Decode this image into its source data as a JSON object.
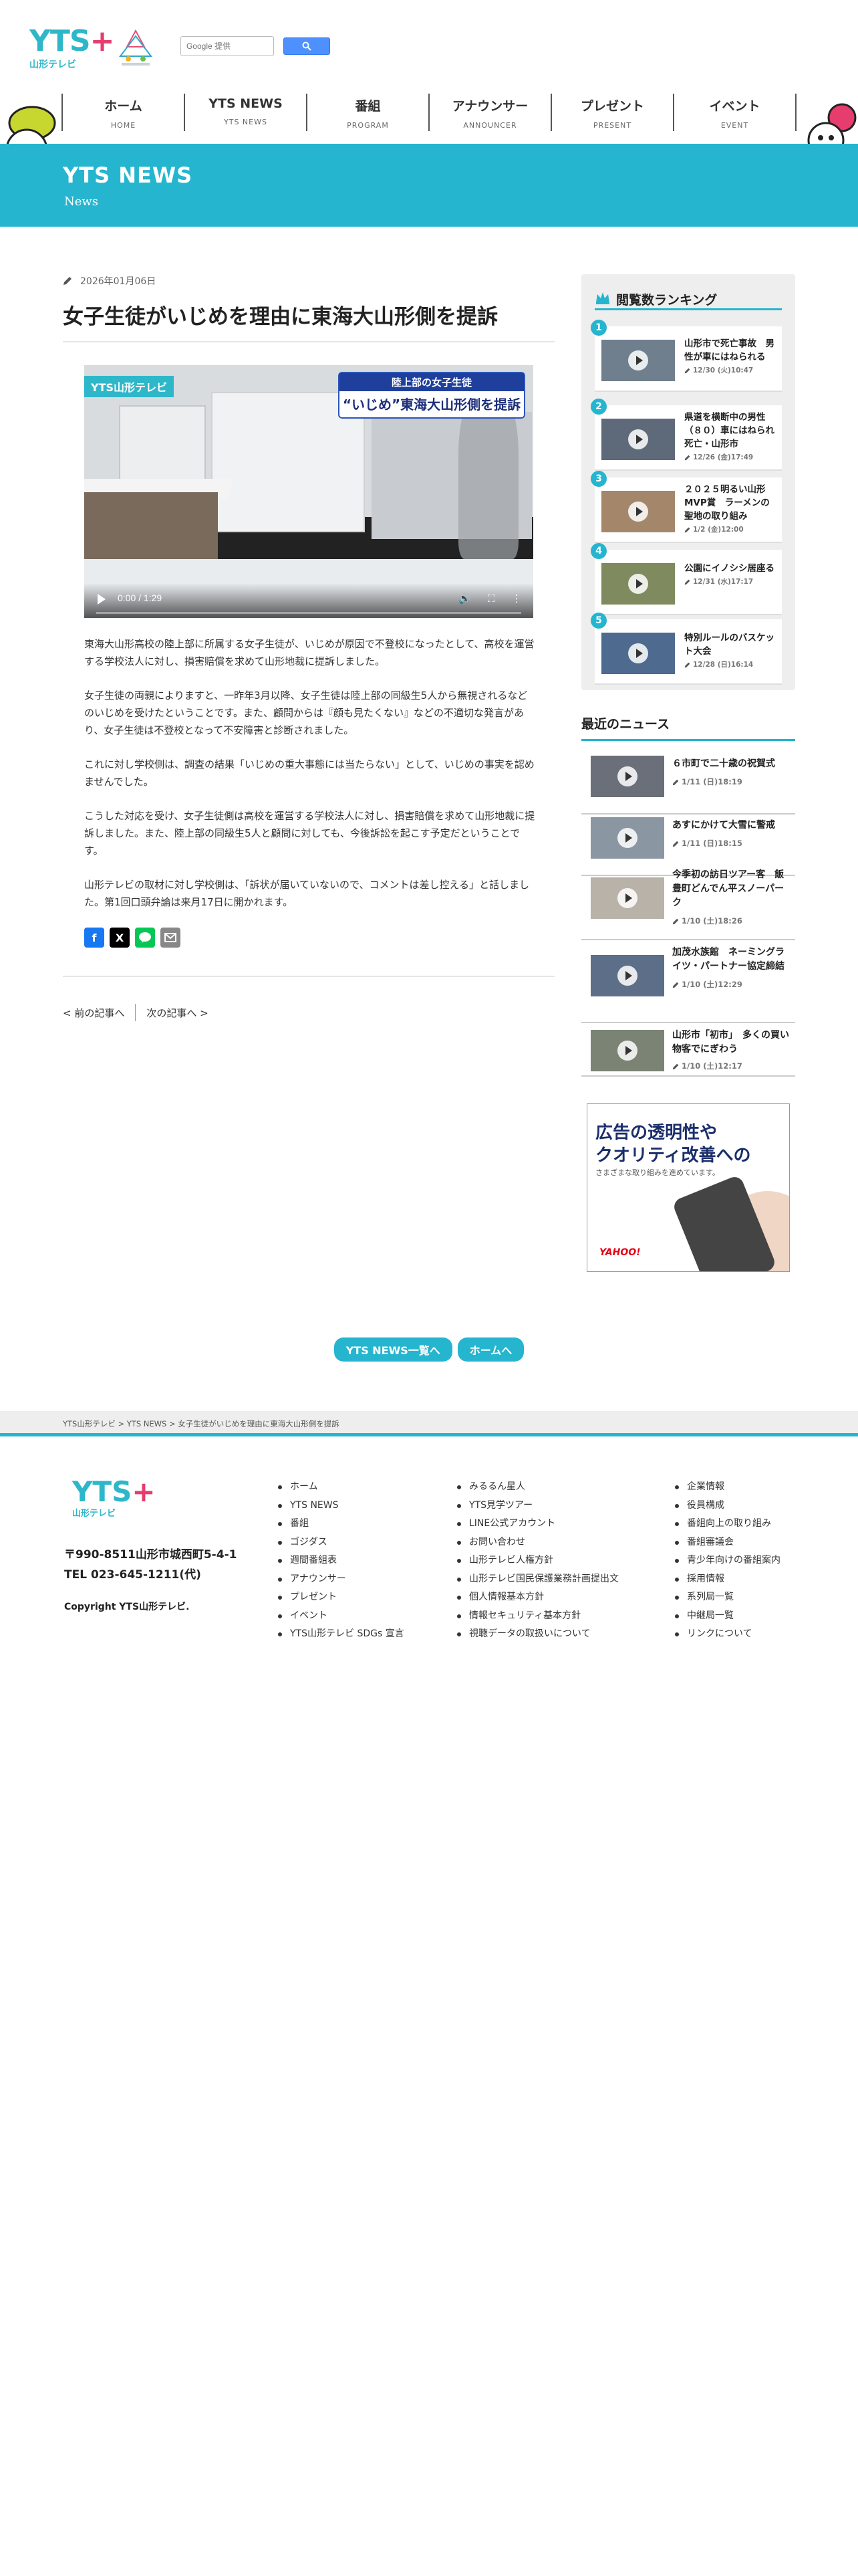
{
  "header": {
    "logo_mark": "YTS",
    "logo_plus": "+",
    "logo_sub": "山形テレビ",
    "search_placeholder": "Google 提供",
    "nav": [
      {
        "jp": "ホーム",
        "en": "HOME"
      },
      {
        "jp": "YTS NEWS",
        "en": "YTS NEWS"
      },
      {
        "jp": "番組",
        "en": "PROGRAM"
      },
      {
        "jp": "アナウンサー",
        "en": "ANNOUNCER"
      },
      {
        "jp": "プレゼント",
        "en": "PRESENT"
      },
      {
        "jp": "イベント",
        "en": "EVENT"
      }
    ]
  },
  "banner": {
    "title": "YTS NEWS",
    "subtitle": "News"
  },
  "article": {
    "date": "2026年01月06日",
    "title": "女子生徒がいじめを理由に東海大山形側を提訴",
    "video": {
      "logo": "YTS山形テレビ",
      "caption_top": "陸上部の女子生徒",
      "caption_main": "“いじめ”東海大山形側を提訴",
      "time": "0:00 / 1:29"
    },
    "paragraphs": [
      "東海大山形高校の陸上部に所属する女子生徒が、いじめが原因で不登校になったとして、高校を運営する学校法人に対し、損害賠償を求めて山形地裁に提訴しました。",
      "女子生徒の両親によりますと、一昨年3月以降、女子生徒は陸上部の同級生5人から無視されるなどのいじめを受けたということです。また、顧問からは『顔も見たくない』などの不適切な発言があり、女子生徒は不登校となって不安障害と診断されました。",
      "これに対し学校側は、調査の結果「いじめの重大事態には当たらない」として、いじめの事実を認めませんでした。",
      "こうした対応を受け、女子生徒側は高校を運営する学校法人に対し、損害賠償を求めて山形地裁に提訴しました。また、陸上部の同級生5人と顧問に対しても、今後訴訟を起こす予定だということです。",
      "山形テレビの取材に対し学校側は、「訴状が届いていないので、コメントは差し控える」と話しました。第1回口頭弁論は来月17日に開かれます。"
    ],
    "prev": "< 前の記事へ",
    "next": "次の記事へ >"
  },
  "ranking": {
    "title": "閲覧数ランキング",
    "items": [
      {
        "num": "1",
        "title": "山形市で死亡事故　男性が車にはねられる",
        "date": "12/30 (火)10:47"
      },
      {
        "num": "2",
        "title": "県道を横断中の男性（８０）車にはねられ死亡・山形市",
        "date": "12/26 (金)17:49"
      },
      {
        "num": "3",
        "title": "２０２５明るい山形MVP賞　ラーメンの聖地の取り組み",
        "date": "1/2 (金)12:00"
      },
      {
        "num": "4",
        "title": "公園にイノシシ居座る",
        "date": "12/31 (水)17:17"
      },
      {
        "num": "5",
        "title": "特別ルールのバスケット大会",
        "date": "12/28 (日)16:14"
      }
    ]
  },
  "recent": {
    "title": "最近のニュース",
    "items": [
      {
        "title": "６市町で二十歳の祝賀式",
        "date": "1/11 (日)18:19"
      },
      {
        "title": "あすにかけて大雪に警戒",
        "date": "1/11 (日)18:15"
      },
      {
        "title": "今季初の訪日ツアー客　飯豊町どんでん平スノーパーク",
        "date": "1/10 (土)18:26"
      },
      {
        "title": "加茂水族館　ネーミングライツ・パートナー協定締結",
        "date": "1/10 (土)12:29"
      },
      {
        "title": "山形市「初市」　多くの買い物客でにぎわう",
        "date": "1/10 (土)12:17"
      }
    ]
  },
  "ad": {
    "line1": "広告の透明性や",
    "line2": "クオリティ改善への",
    "line3": "さまざまな取り組みを進めています。",
    "brand": "YAHOO!"
  },
  "bottom": {
    "news_list": "YTS NEWS一覧へ",
    "home": "ホームへ"
  },
  "breadcrumb": "YTS山形テレビ > YTS NEWS > 女子生徒がいじめを理由に東海大山形側を提訴",
  "footer": {
    "address": "〒990-8511山形市城西町5-4-1",
    "tel": "TEL 023-645-1211(代)",
    "copyright": "Copyright YTS山形テレビ.",
    "col1": [
      "ホーム",
      "YTS NEWS",
      "番組",
      "ゴジダス",
      "週間番組表",
      "アナウンサー",
      "プレゼント",
      "イベント",
      "YTS山形テレビ SDGs 宣言"
    ],
    "col2": [
      "みるるん星人",
      "YTS見学ツアー",
      "LINE公式アカウント",
      "お問い合わせ",
      "山形テレビ人権方針",
      "山形テレビ国民保護業務計画提出文",
      "個人情報基本方針",
      "情報セキュリティ基本方針",
      "視聴データの取扱いについて"
    ],
    "col3": [
      "企業情報",
      "役員構成",
      "番組向上の取り組み",
      "番組審議会",
      "青少年向けの番組案内",
      "採用情報",
      "系列局一覧",
      "中継局一覧",
      "リンクについて"
    ]
  },
  "colors": {
    "accent": "#25b5cf",
    "logo_pink": "#e73c6e"
  }
}
